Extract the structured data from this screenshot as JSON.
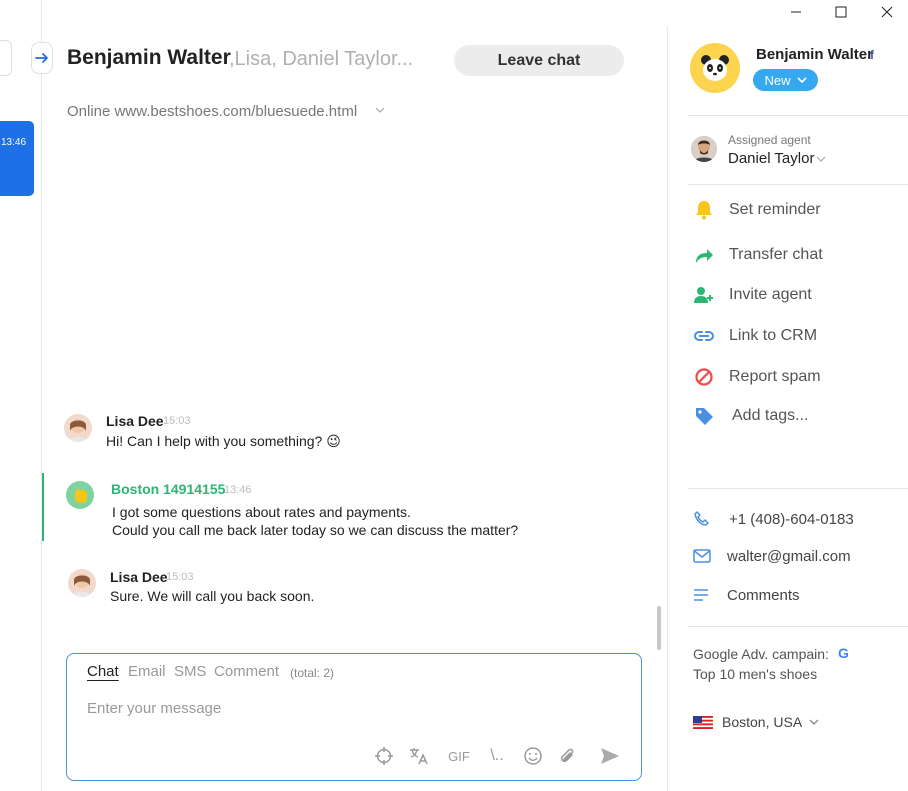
{
  "left_strip": {
    "time": "13:46"
  },
  "header": {
    "name": "Benjamin Walter",
    "others": ",Lisa, Daniel Taylor...",
    "leave_label": "Leave chat",
    "status": "Online www.bestshoes.com/bluesuede.html"
  },
  "messages": [
    {
      "name": "Lisa Dee",
      "time": "15:03",
      "lines": [
        "Hi! Can I help with you something? 😉"
      ]
    },
    {
      "name": "Boston 14914155",
      "time": "13:46",
      "lines": [
        "I got some questions about rates and payments.",
        "Could you call me back later today so we can discuss the matter?"
      ]
    },
    {
      "name": "Lisa Dee",
      "time": "15:03",
      "lines": [
        "Sure. We will call you back soon."
      ]
    }
  ],
  "composer": {
    "tabs": [
      "Chat",
      "Email",
      "SMS",
      "Comment"
    ],
    "total": "(total: 2)",
    "placeholder": "Enter your message",
    "gif_label": "GIF",
    "slash_label": "\\..",
    "tools": [
      "crosshair-icon",
      "translate-icon",
      "gif-icon",
      "shortcut-icon",
      "emoji-icon",
      "attach-icon",
      "send-icon"
    ]
  },
  "panel": {
    "name": "Benjamin Walter",
    "fb": "f",
    "badge": "New",
    "assigned_label": "Assigned agent",
    "assigned_name": "Daniel Taylor",
    "actions": [
      {
        "label": "Set reminder",
        "icon": "bell-icon",
        "color": "#f5c518"
      },
      {
        "label": "Transfer chat",
        "icon": "transfer-arrow-icon",
        "color": "#2bb673"
      },
      {
        "label": "Invite agent",
        "icon": "add-user-icon",
        "color": "#2bb673"
      },
      {
        "label": "Link to CRM",
        "icon": "link-icon",
        "color": "#4a90e2"
      },
      {
        "label": "Report spam",
        "icon": "block-icon",
        "color": "#f04a4a"
      },
      {
        "label": "Add tags...",
        "icon": "tag-icon",
        "color": "#4a90e2"
      }
    ],
    "phone": "+1 (408)-604-0183",
    "email": "walter@gmail.com",
    "comments": "Comments",
    "campaign_label": "Google Adv. campain:",
    "campaign_value": "Top 10 men's shoes",
    "google_g": "G",
    "location": "Boston, USA"
  },
  "colors": {
    "accent": "#1f6fe6",
    "green": "#2bb673",
    "badge": "#35a8f0",
    "composer_border": "#4a90e2"
  }
}
